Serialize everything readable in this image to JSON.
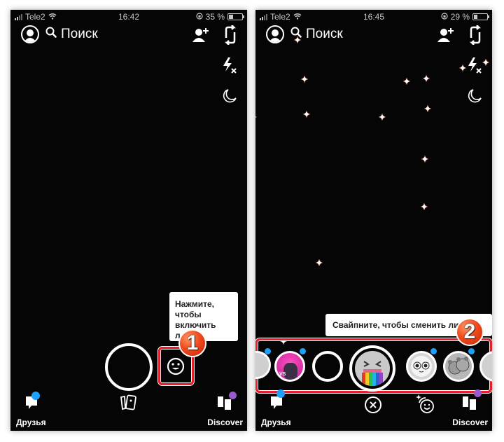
{
  "screens": [
    {
      "status": {
        "carrier": "Tele2",
        "time": "16:42",
        "battery": "35 %",
        "battery_level": 0.35
      },
      "search_label": "Поиск",
      "tooltip": {
        "lines": [
          "Нажмите,",
          "чтобы",
          "включить",
          "л..."
        ]
      },
      "step_badge": "1",
      "bottom": {
        "friends_label": "Друзья",
        "discover_label": "Discover"
      },
      "icons": {
        "avatar": "bitmoji-avatar-icon",
        "search": "search-icon",
        "add_friend": "add-friend-icon",
        "flip_camera": "flip-camera-icon",
        "flash_off": "flash-off-icon",
        "night_mode": "moon-icon",
        "lenses": "smiley-icon",
        "memories": "memories-icon",
        "chat": "chat-icon",
        "discover": "discover-icon"
      }
    },
    {
      "status": {
        "carrier": "Tele2",
        "time": "16:45",
        "battery": "29 %",
        "battery_level": 0.29
      },
      "search_label": "Поиск",
      "tooltip": {
        "text": "Свайпните, чтобы сменить лин..."
      },
      "step_badge": "2",
      "lenses": [
        {
          "name": "lens-partial-left",
          "has_new_dot": true
        },
        {
          "name": "lens-purple-character",
          "has_new_dot": true,
          "label": "VS"
        },
        {
          "name": "lens-empty-capture",
          "has_new_dot": false
        },
        {
          "name": "lens-rainbow-vomit",
          "has_new_dot": false,
          "selected": true
        },
        {
          "name": "lens-glasses-face",
          "has_new_dot": true
        },
        {
          "name": "lens-bears",
          "has_new_dot": true
        },
        {
          "name": "lens-partial-right",
          "has_new_dot": false
        }
      ],
      "bottom": {
        "friends_label": "Друзья",
        "discover_label": "Discover"
      },
      "icons": {
        "close": "close-icon",
        "lens_explorer": "lens-explorer-icon"
      }
    }
  ],
  "colors": {
    "highlight_red": "#e4202a",
    "new_dot_blue": "#1ea0ff",
    "discover_purple": "#9b59d0",
    "badge_orange": "#f04a1c"
  }
}
